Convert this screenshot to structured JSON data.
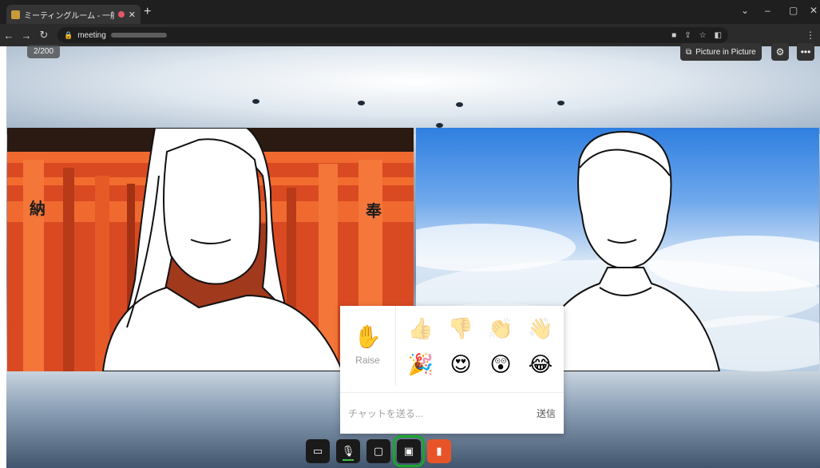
{
  "browser": {
    "tab_title": "ミーティングルーム - 一般社団法人",
    "new_tab_icon": "plus-icon",
    "url_prefix": "meeting",
    "window_controls": [
      "⌄",
      "–",
      "▢",
      "✕"
    ]
  },
  "meeting": {
    "participant_count": "2/200",
    "pip_label": "Picture in Picture",
    "kanji_left": "納",
    "kanji_right": "奉"
  },
  "reactions": {
    "raise_label": "Raise",
    "emoji": [
      {
        "char": "👍",
        "name": "thumbs-up-icon",
        "faded": true
      },
      {
        "char": "👎",
        "name": "thumbs-down-icon",
        "faded": true
      },
      {
        "char": "👏",
        "name": "clap-icon",
        "faded": true
      },
      {
        "char": "👋",
        "name": "wave-icon",
        "faded": true
      },
      {
        "char": "🎉",
        "name": "party-popper-icon",
        "faded": false
      },
      {
        "char": "😍",
        "name": "heart-eyes-icon",
        "faded": false
      },
      {
        "char": "😲",
        "name": "surprised-face-icon",
        "faded": false
      },
      {
        "char": "😂",
        "name": "tears-of-joy-icon",
        "faded": false
      }
    ]
  },
  "chat": {
    "placeholder": "チャットを送る...",
    "send_label": "送信"
  },
  "controls": {
    "accent_color": "#1aa52a",
    "leave_color": "#e8542a"
  }
}
